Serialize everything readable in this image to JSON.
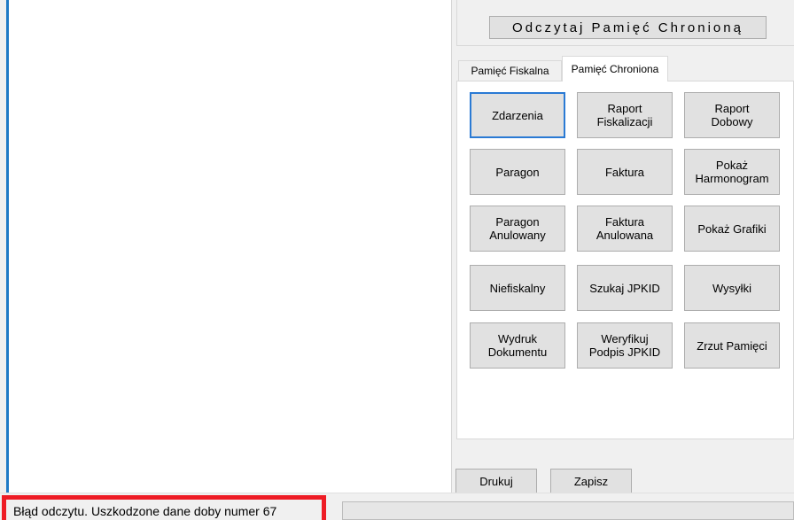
{
  "header": {
    "read_button_label": "Odczytaj Pamięć Chronioną"
  },
  "tabs": [
    {
      "label": "Pamięć Fiskalna",
      "selected": false
    },
    {
      "label": "Pamięć Chroniona",
      "selected": true
    }
  ],
  "grid_buttons": [
    [
      "Zdarzenia",
      "Raport\nFiskalizacji",
      "Raport\nDobowy"
    ],
    [
      "Paragon",
      "Faktura",
      "Pokaż\nHarmonogram"
    ],
    [
      "Paragon\nAnulowany",
      "Faktura\nAnulowana",
      "Pokaż Grafiki"
    ],
    [
      "Niefiskalny",
      "Szukaj JPKID",
      "Wysyłki"
    ],
    [
      "Wydruk\nDokumentu",
      "Weryfikuj\nPodpis JPKID",
      "Zrzut Pamięci"
    ]
  ],
  "actions": {
    "print_label": "Drukuj",
    "save_label": "Zapisz"
  },
  "status": {
    "message": "Błąd odczytu. Uszkodzone dane doby numer 67",
    "highlight_color": "#ee1c25"
  },
  "colors": {
    "accent": "#1f7ac6",
    "focus_border": "#2a7ad4"
  }
}
